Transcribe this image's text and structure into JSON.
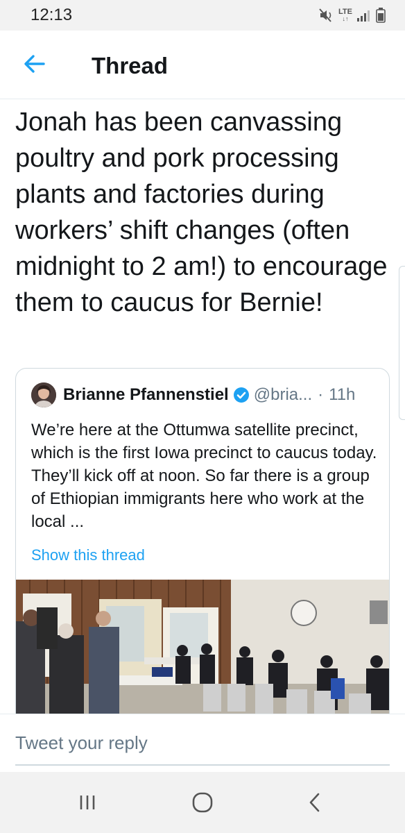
{
  "status_bar": {
    "time": "12:13",
    "network": "LTE"
  },
  "header": {
    "title": "Thread",
    "back_icon": "back-arrow-icon"
  },
  "tweet": {
    "text": "Jonah has been canvassing poultry and pork processing plants and factories during workers’ shift changes (often midnight to 2 am!) to encourage them to caucus for Bernie!"
  },
  "quoted_tweet": {
    "author": "Brianne Pfannenstiel",
    "handle": "@bria...",
    "separator": "·",
    "age": "11h",
    "text": "We’re here at the Ottumwa satellite precinct, which is the first Iowa precinct to caucus today. They’ll kick off at noon. So far there is a group of Ethiopian immigrants here who work at the local ...",
    "show_thread": "Show this thread"
  },
  "reply": {
    "placeholder": "Tweet your reply"
  },
  "colors": {
    "accent": "#1da1f2",
    "text": "#14171a",
    "muted": "#657786"
  }
}
